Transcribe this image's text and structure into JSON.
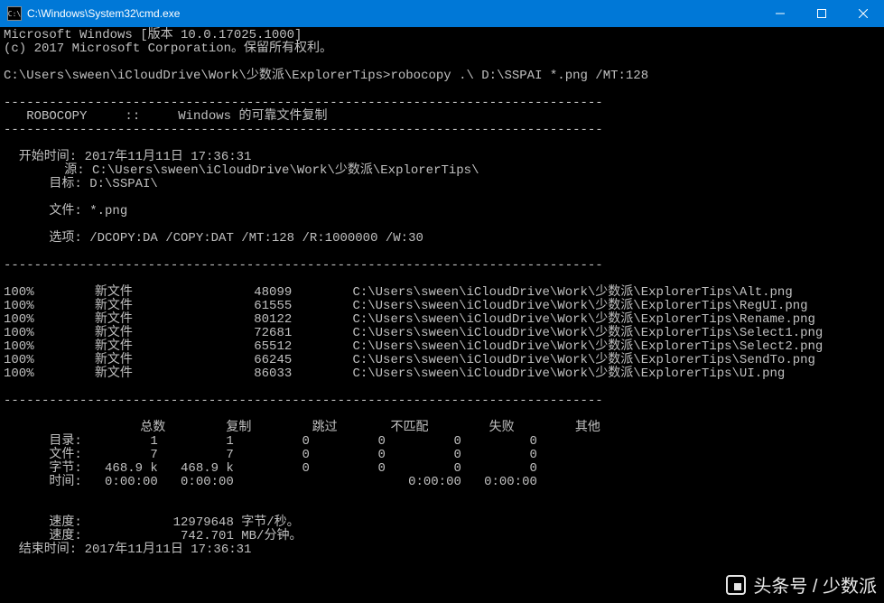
{
  "window": {
    "title": "C:\\Windows\\System32\\cmd.exe",
    "icon_label": "C:\\"
  },
  "header": {
    "line1": "Microsoft Windows [版本 10.0.17025.1000]",
    "line2": "(c) 2017 Microsoft Corporation。保留所有权利。"
  },
  "prompt_line": "C:\\Users\\sween\\iCloudDrive\\Work\\少数派\\ExplorerTips>robocopy .\\ D:\\SSPAI *.png /MT:128",
  "divider": "-------------------------------------------------------------------------------",
  "robocopy_title": "   ROBOCOPY     ::     Windows 的可靠文件复制",
  "info": {
    "start_label": "  开始时间: ",
    "start_value": "2017年11月11日 17:36:31",
    "source_label": "        源: ",
    "source_value": "C:\\Users\\sween\\iCloudDrive\\Work\\少数派\\ExplorerTips\\",
    "target_label": "      目标: ",
    "target_value": "D:\\SSPAI\\",
    "files_label": "      文件: ",
    "files_value": "*.png",
    "options_label": "      选项: ",
    "options_value": "/DCOPY:DA /COPY:DAT /MT:128 /R:1000000 /W:30"
  },
  "files": [
    {
      "pct": "100%",
      "tag": "新文件",
      "size": "48099",
      "path": "C:\\Users\\sween\\iCloudDrive\\Work\\少数派\\ExplorerTips\\Alt.png"
    },
    {
      "pct": "100%",
      "tag": "新文件",
      "size": "61555",
      "path": "C:\\Users\\sween\\iCloudDrive\\Work\\少数派\\ExplorerTips\\RegUI.png"
    },
    {
      "pct": "100%",
      "tag": "新文件",
      "size": "80122",
      "path": "C:\\Users\\sween\\iCloudDrive\\Work\\少数派\\ExplorerTips\\Rename.png"
    },
    {
      "pct": "100%",
      "tag": "新文件",
      "size": "72681",
      "path": "C:\\Users\\sween\\iCloudDrive\\Work\\少数派\\ExplorerTips\\Select1.png"
    },
    {
      "pct": "100%",
      "tag": "新文件",
      "size": "65512",
      "path": "C:\\Users\\sween\\iCloudDrive\\Work\\少数派\\ExplorerTips\\Select2.png"
    },
    {
      "pct": "100%",
      "tag": "新文件",
      "size": "66245",
      "path": "C:\\Users\\sween\\iCloudDrive\\Work\\少数派\\ExplorerTips\\SendTo.png"
    },
    {
      "pct": "100%",
      "tag": "新文件",
      "size": "86033",
      "path": "C:\\Users\\sween\\iCloudDrive\\Work\\少数派\\ExplorerTips\\UI.png"
    }
  ],
  "summary": {
    "header": "                  总数        复制        跳过       不匹配        失败        其他",
    "rows": {
      "dir": "      目录:         1         1         0         0         0         0",
      "file": "      文件:         7         7         0         0         0         0",
      "bytes": "      字节:   468.9 k   468.9 k         0         0         0         0",
      "time": "      时间:   0:00:00   0:00:00                       0:00:00   0:00:00"
    },
    "speed1_label": "      速度:",
    "speed1_value": "            12979648 字节/秒。",
    "speed2_label": "      速度:",
    "speed2_value": "             742.701 MB/分钟。",
    "end_label": "  结束时间: ",
    "end_value": "2017年11月11日 17:36:31"
  },
  "watermark": "头条号 / 少数派"
}
